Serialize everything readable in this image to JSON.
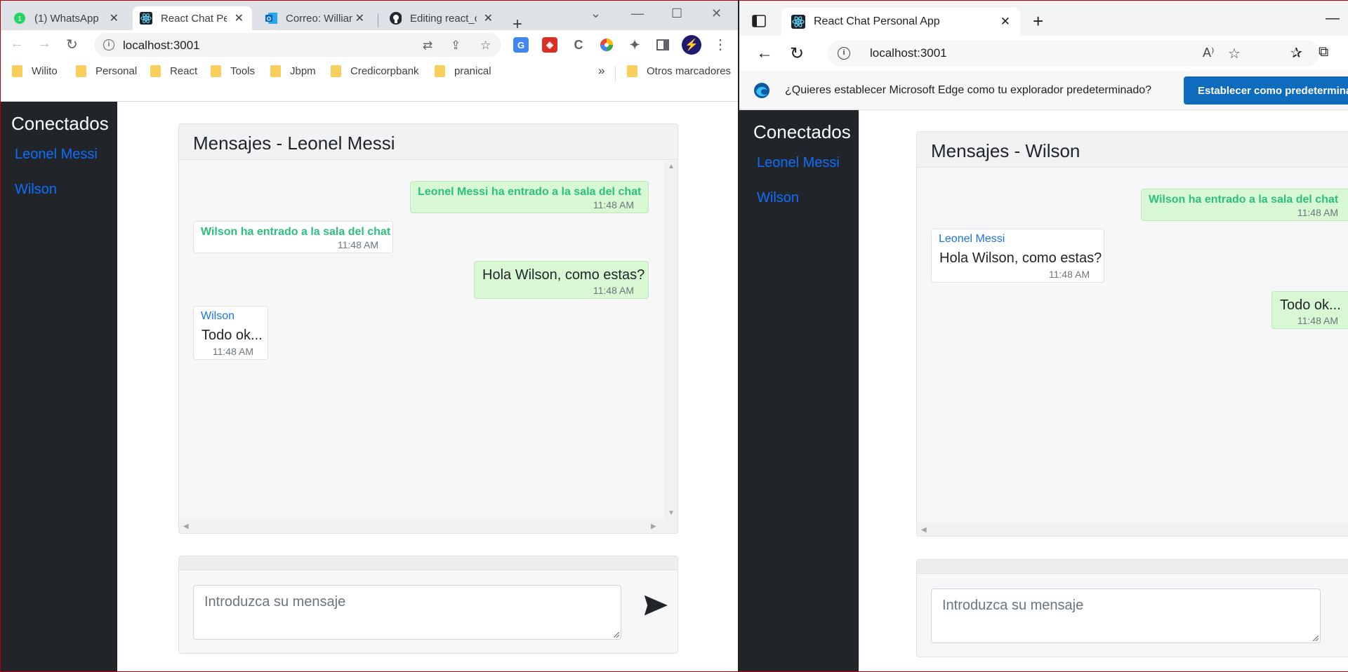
{
  "chrome": {
    "tabs": [
      {
        "title": "(1) WhatsApp",
        "badge": "1"
      },
      {
        "title": "React Chat Personal App"
      },
      {
        "title": "Correo: William"
      },
      {
        "title": "Editing react_c"
      }
    ],
    "url": "localhost:3001",
    "bookmarks": [
      "Wilito",
      "Personal",
      "React",
      "Tools",
      "Jbpm",
      "Credicorpbank",
      "pranical"
    ],
    "bookmarks_more": "»",
    "other_bookmarks": "Otros marcadores"
  },
  "left_app": {
    "sidebar_title": "Conectados",
    "users": [
      "Leonel Messi",
      "Wilson"
    ],
    "header": "Mensajes - Leonel Messi",
    "messages": [
      {
        "system": "Leonel Messi ha entrado a la sala del chat",
        "time": "11:48 AM"
      },
      {
        "system": "Wilson ha entrado a la sala del chat",
        "time": "11:48 AM"
      },
      {
        "text": "Hola Wilson, como estas?",
        "time": "11:48 AM"
      },
      {
        "from": "Wilson",
        "text": "Todo ok...",
        "time": "11:48 AM"
      }
    ],
    "placeholder": "Introduzca su mensaje"
  },
  "edge": {
    "tab_title": "React Chat Personal App",
    "url": "localhost:3001",
    "banner_text": "¿Quieres establecer Microsoft Edge como tu explorador predeterminado?",
    "banner_button": "Establecer como predeterminado"
  },
  "right_app": {
    "sidebar_title": "Conectados",
    "users": [
      "Leonel Messi",
      "Wilson"
    ],
    "header": "Mensajes - Wilson",
    "messages": [
      {
        "system": "Wilson ha entrado a la sala del chat",
        "time": "11:48 AM"
      },
      {
        "from": "Leonel Messi",
        "text": "Hola Wilson, como estas?",
        "time": "11:48 AM"
      },
      {
        "text": "Todo ok...",
        "time": "11:48 AM"
      }
    ],
    "placeholder": "Introduzca su mensaje"
  }
}
